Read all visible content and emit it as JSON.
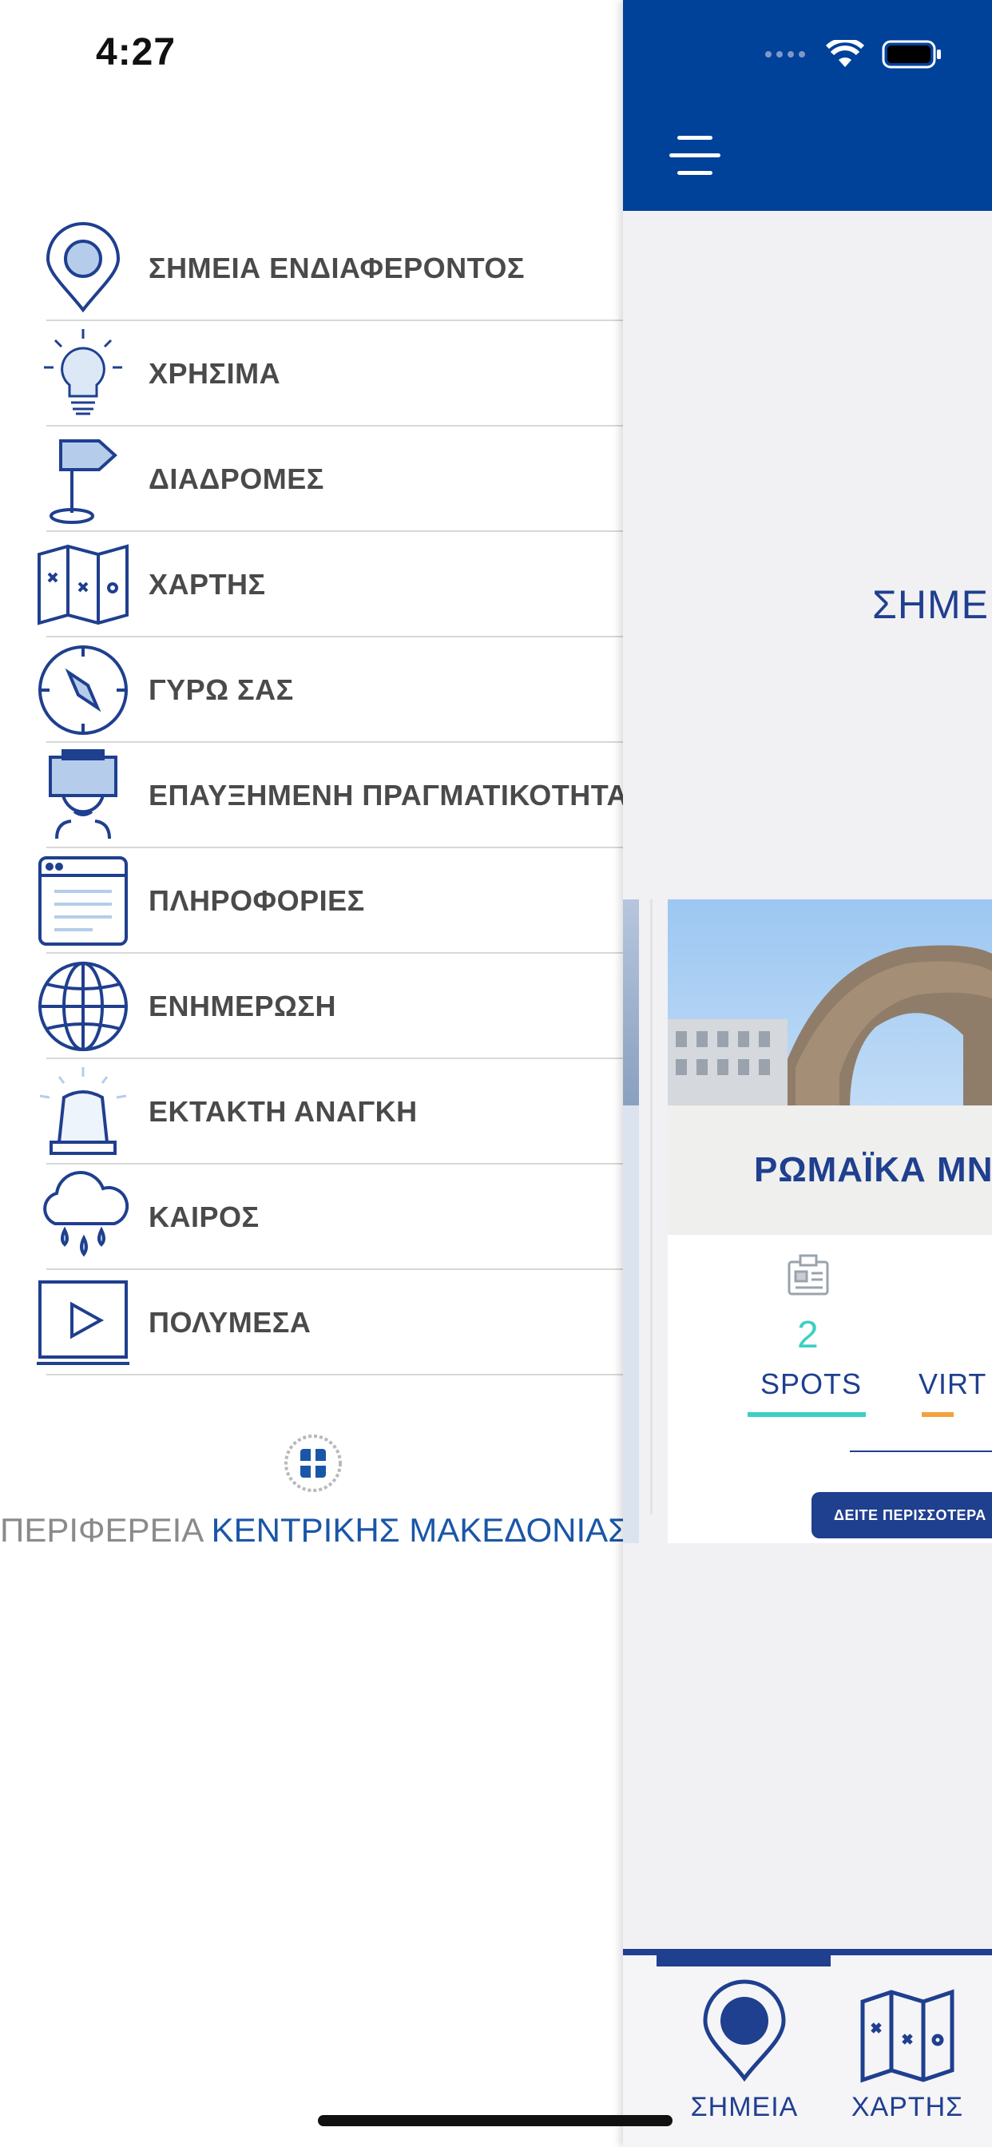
{
  "status_bar": {
    "time": "4:27"
  },
  "menu": {
    "items": [
      {
        "label": "ΣΗΜΕΙΑ ΕΝΔΙΑΦΕΡΟΝΤΟΣ",
        "icon": "map-pin-icon"
      },
      {
        "label": "ΧΡΗΣΙΜΑ",
        "icon": "lightbulb-icon"
      },
      {
        "label": "ΔΙΑΔΡΟΜΕΣ",
        "icon": "signpost-icon"
      },
      {
        "label": "ΧΑΡΤΗΣ",
        "icon": "folded-map-icon"
      },
      {
        "label": "ΓΥΡΩ ΣΑΣ",
        "icon": "compass-icon"
      },
      {
        "label": "ΕΠΑΥΞΗΜΕΝΗ ΠΡΑΓΜΑΤΙΚΟΤΗΤΑ",
        "icon": "vr-headset-icon"
      },
      {
        "label": "ΠΛΗΡΟΦΟΡΙΕΣ",
        "icon": "browser-window-icon"
      },
      {
        "label": "ΕΝΗΜΕΡΩΣΗ",
        "icon": "globe-icon"
      },
      {
        "label": "ΕΚΤΑΚΤΗ ΑΝΑΓΚΗ",
        "icon": "siren-icon"
      },
      {
        "label": "ΚΑΙΡΟΣ",
        "icon": "rain-cloud-icon"
      },
      {
        "label": "ΠΟΛΥΜΕΣΑ",
        "icon": "play-screen-icon"
      }
    ]
  },
  "footer": {
    "region_gray": "ΠΕΡΙΦΕΡΕΙΑ",
    "region_blue": "ΚΕΝΤΡΙΚΗΣ ΜΑΚΕΔΟΝΙΑΣ"
  },
  "panel": {
    "section_title": "ΣΗΜΕΙ",
    "card": {
      "title": "ΡΩΜΑΪΚΑ ΜΝΗ",
      "spots_count": "2",
      "spots_label": "SPOTS",
      "virtual_label": "VIRT",
      "more_button": "ΔΕΙΤΕ ΠΕΡΙΣΣΟΤΕΡΑ"
    },
    "tabs": [
      {
        "label": "ΣΗΜΕΙΑ",
        "icon": "map-pin-icon",
        "selected": true
      },
      {
        "label": "ΧΑΡΤΗΣ",
        "icon": "folded-map-icon",
        "selected": false
      }
    ]
  },
  "colors": {
    "brand_blue": "#00419a",
    "accent_teal": "#3ccfc2",
    "accent_orange": "#f2a23b",
    "text_navy": "#1f3f8f"
  }
}
